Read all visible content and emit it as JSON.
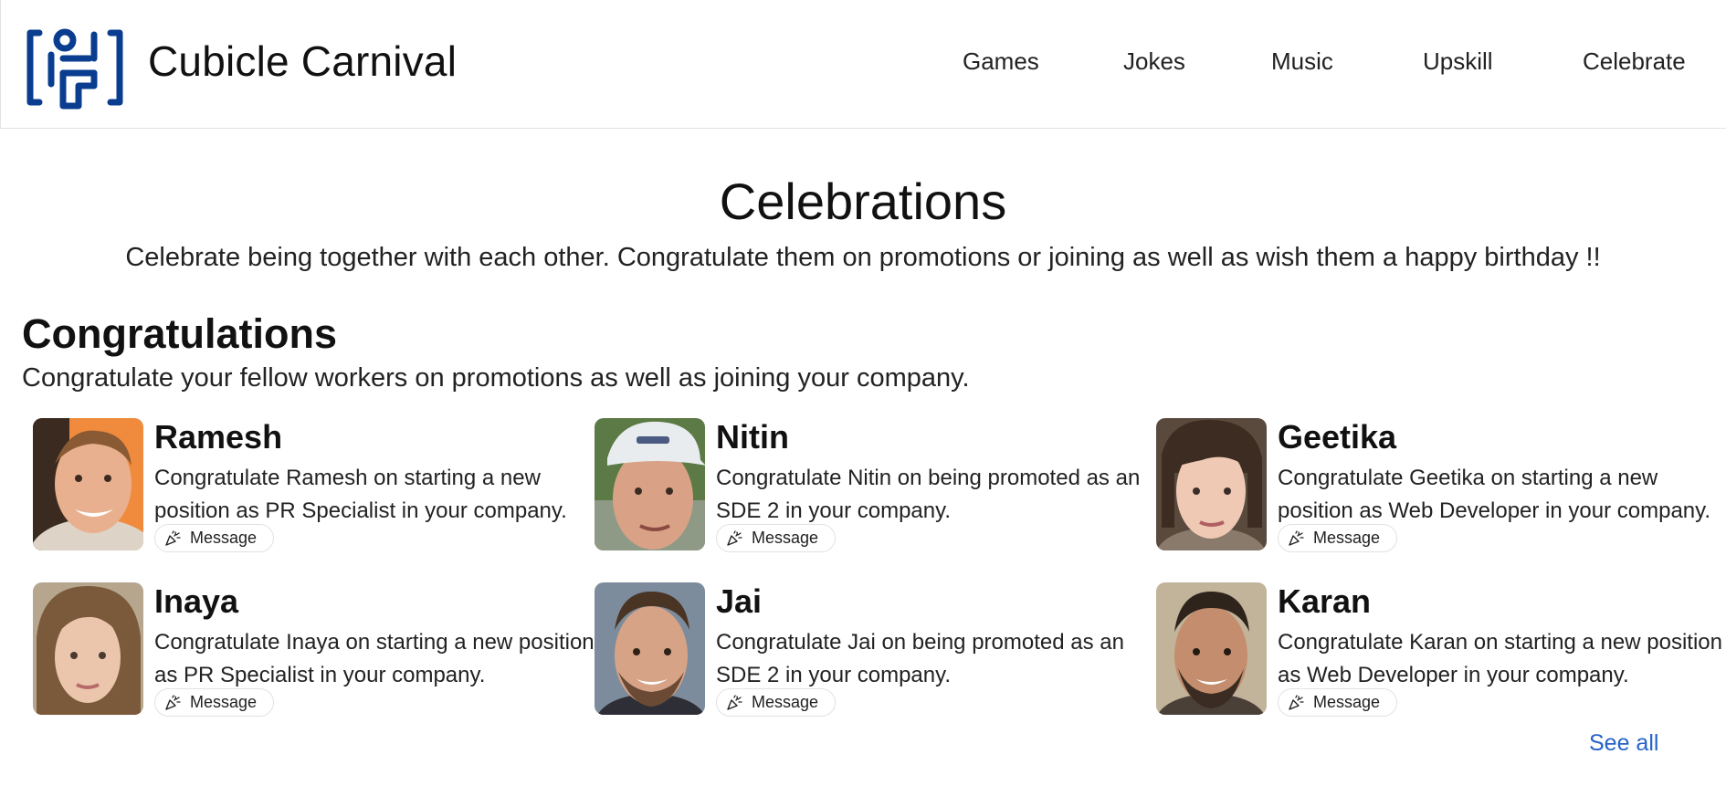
{
  "header": {
    "brand": "Cubicle Carnival",
    "nav": [
      "Games",
      "Jokes",
      "Music",
      "Upskill",
      "Celebrate"
    ],
    "logo_color": "#0a3d8f"
  },
  "page": {
    "title": "Celebrations",
    "subtitle": "Celebrate being together with each other. Congratulate them on promotions or joining as well as wish them a happy birthday !!"
  },
  "congratulations": {
    "title": "Congratulations",
    "subtitle": "Congratulate your fellow workers on promotions as well as joining your company.",
    "see_all": "See all",
    "people": [
      {
        "name": "Ramesh",
        "text": "Congratulate Ramesh on starting a new position as PR Specialist in your company.",
        "button": "Message",
        "avatar_icon": "person-photo"
      },
      {
        "name": "Nitin",
        "text": "Congratulate Nitin on being promoted as an SDE 2 in your company.",
        "button": "Message",
        "avatar_icon": "person-photo"
      },
      {
        "name": "Geetika",
        "text": "Congratulate Geetika on starting a new position as Web Developer in your company.",
        "button": "Message",
        "avatar_icon": "person-photo"
      },
      {
        "name": "Inaya",
        "text": "Congratulate Inaya on starting a new position as PR Specialist in your company.",
        "button": "Message",
        "avatar_icon": "person-photo"
      },
      {
        "name": "Jai",
        "text": "Congratulate Jai on being promoted as an SDE 2 in your company.",
        "button": "Message",
        "avatar_icon": "person-photo"
      },
      {
        "name": "Karan",
        "text": "Congratulate Karan on starting a new position as Web Developer in your company.",
        "button": "Message",
        "avatar_icon": "person-photo"
      }
    ]
  },
  "colors": {
    "link": "#2563c9",
    "text": "#111111"
  }
}
